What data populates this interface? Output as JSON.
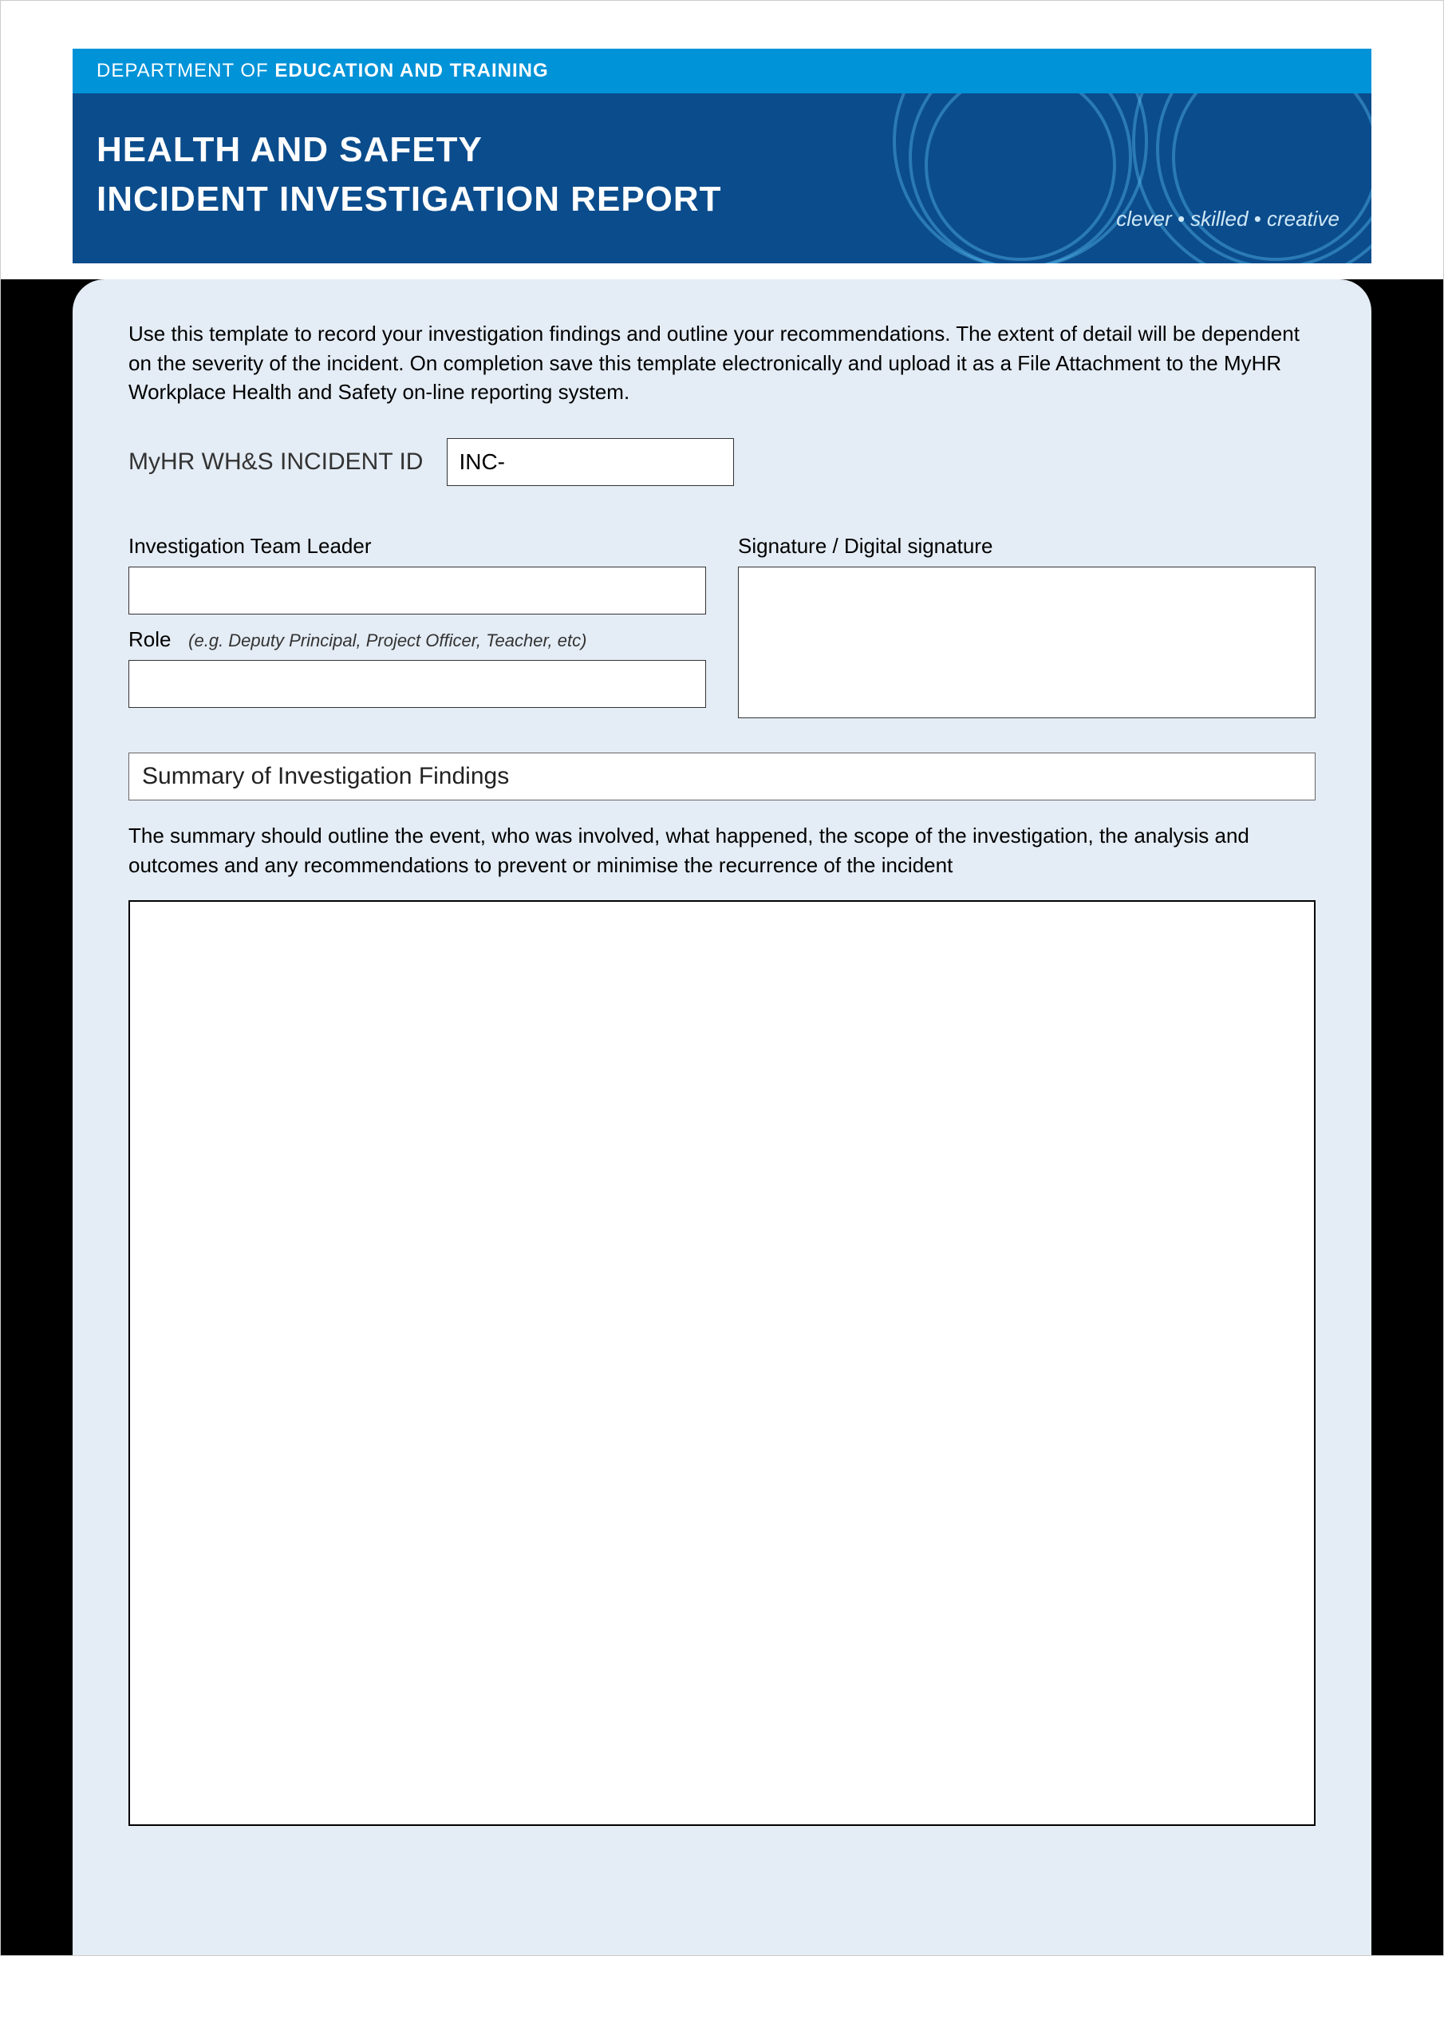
{
  "header": {
    "department_prefix": "DEPARTMENT OF ",
    "department_bold": "EDUCATION AND TRAINING",
    "title_line1": "HEALTH AND SAFETY",
    "title_line2": "INCIDENT INVESTIGATION REPORT",
    "tagline": "clever • skilled • creative"
  },
  "intro_text": "Use this template to record your investigation findings and outline your recommendations. The extent of detail will be dependent on the severity of the incident. On completion save this template electronically and upload it as a File Attachment to the MyHR Workplace Health and Safety on-line reporting system.",
  "incident": {
    "label": "MyHR WH&S INCIDENT ID",
    "value": "INC-"
  },
  "team_leader": {
    "label": "Investigation Team Leader",
    "value": ""
  },
  "role": {
    "label": "Role",
    "hint": "(e.g. Deputy Principal, Project Officer, Teacher, etc)",
    "value": ""
  },
  "signature": {
    "label": "Signature / Digital signature"
  },
  "summary": {
    "heading": "Summary of Investigation Findings",
    "description": "The summary should outline the event, who was involved, what happened, the scope of the investigation, the analysis and outcomes and any recommendations to prevent or minimise the recurrence of the incident",
    "value": ""
  }
}
